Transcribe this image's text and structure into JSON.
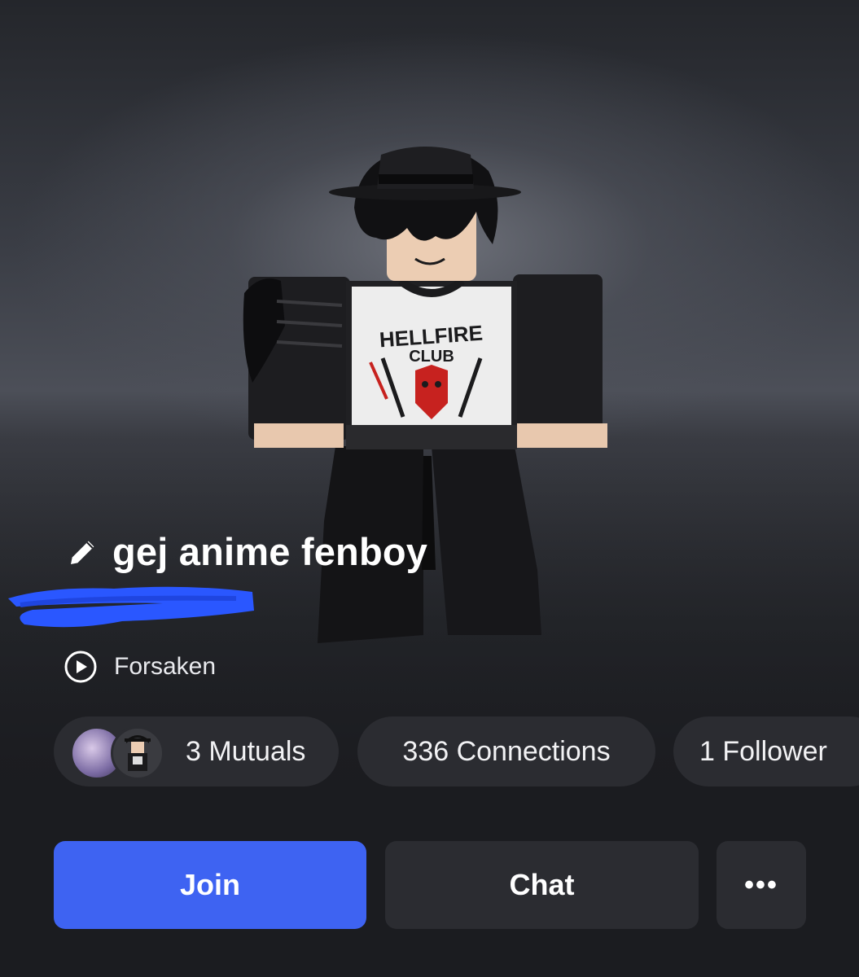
{
  "profile": {
    "display_name": "gej anime fenboy",
    "shirt_print_line1": "HELLFIRE",
    "shirt_print_line2": "CLUB"
  },
  "presence": {
    "game_name": "Forsaken",
    "icon": "play-circle-icon"
  },
  "stats": {
    "mutuals": "3 Mutuals",
    "connections": "336 Connections",
    "followers": "1 Follower"
  },
  "actions": {
    "join_label": "Join",
    "chat_label": "Chat",
    "more_label": "•••"
  },
  "colors": {
    "accent": "#3e63f2",
    "surface": "#2b2c31",
    "background": "#1b1c20",
    "redaction": "#2a57ff"
  }
}
